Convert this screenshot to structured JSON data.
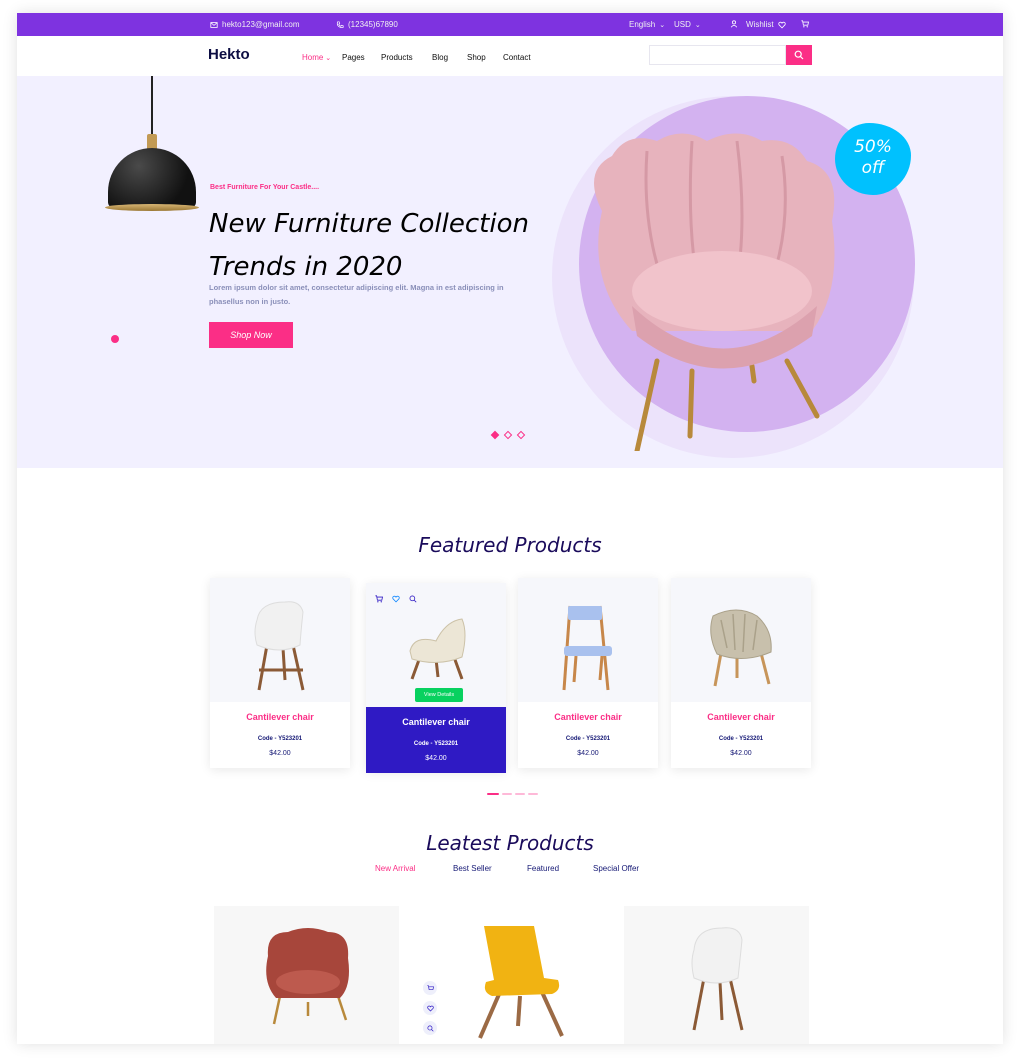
{
  "topbar": {
    "email": "hekto123@gmail.com",
    "phone": "(12345)67890",
    "language": "English",
    "currency": "USD",
    "wishlist": "Wishlist"
  },
  "nav": {
    "logo": "Hekto",
    "links": [
      "Home",
      "Pages",
      "Products",
      "Blog",
      "Shop",
      "Contact"
    ],
    "search_placeholder": ""
  },
  "hero": {
    "kicker": "Best Furniture For Your Castle....",
    "title_line1": "New Furniture Collection",
    "title_line2": "Trends in 2020",
    "description": "Lorem ipsum dolor sit amet, consectetur adipiscing elit. Magna in est adipiscing in phasellus non in justo.",
    "button": "Shop Now",
    "discount_line1": "50%",
    "discount_line2": "off"
  },
  "featured": {
    "title": "Featured Products",
    "view_details": "View Details",
    "products": [
      {
        "name": "Cantilever chair",
        "code": "Code - Y523201",
        "price": "$42.00"
      },
      {
        "name": "Cantilever chair",
        "code": "Code - Y523201",
        "price": "$42.00"
      },
      {
        "name": "Cantilever chair",
        "code": "Code - Y523201",
        "price": "$42.00"
      },
      {
        "name": "Cantilever chair",
        "code": "Code - Y523201",
        "price": "$42.00"
      }
    ]
  },
  "latest": {
    "title": "Leatest Products",
    "tabs": [
      "New Arrival",
      "Best Seller",
      "Featured",
      "Special Offer"
    ]
  },
  "colors": {
    "primary_purple": "#7e33e0",
    "pink": "#fb2e86",
    "navy": "#151875",
    "active_card": "#2f1ac4",
    "green": "#08d15f",
    "sky": "#00c1fe"
  }
}
